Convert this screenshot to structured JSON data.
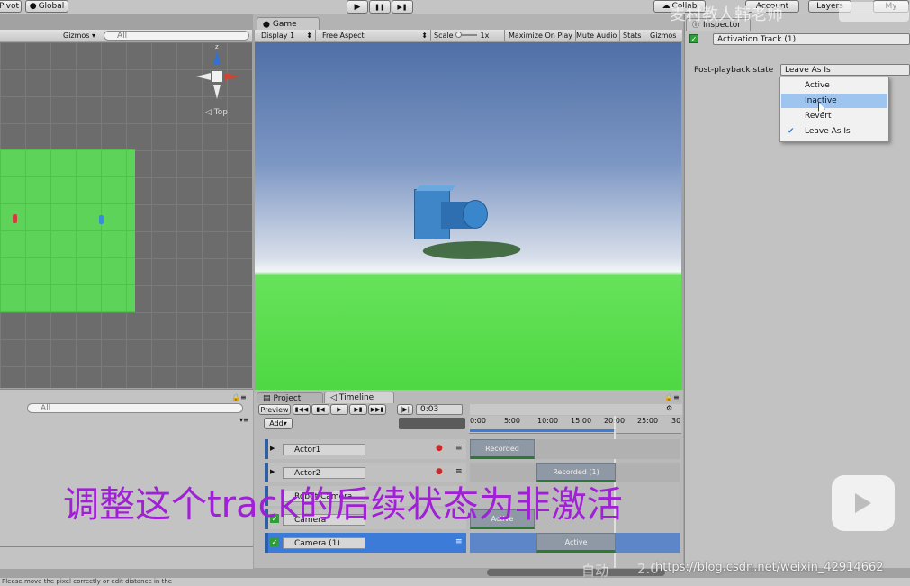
{
  "toolbar": {
    "pivot": "Pivot",
    "global": "Global",
    "play": "▶",
    "pause": "❚❚",
    "step": "▶❚",
    "collab": "Collab",
    "account": "Account",
    "layers": "Layers",
    "layout": "My"
  },
  "scene": {
    "gizmos": "Gizmos",
    "search_placeholder": "All",
    "view_label": "Top",
    "gizmo_axis_z": "z"
  },
  "game": {
    "tab": "Game",
    "display": "Display 1",
    "aspect": "Free Aspect",
    "scale_label": "Scale",
    "scale_value": "1x",
    "maximize": "Maximize On Play",
    "mute": "Mute Audio",
    "stats": "Stats",
    "gizmos": "Gizmos"
  },
  "inspector": {
    "tab": "Inspector",
    "track_name": "Activation Track (1)",
    "post_playback_label": "Post-playback state",
    "post_playback_value": "Leave As Is",
    "options": [
      {
        "label": "Active",
        "selected": false,
        "highlighted": false
      },
      {
        "label": "Inactive",
        "selected": false,
        "highlighted": true
      },
      {
        "label": "Revert",
        "selected": false,
        "highlighted": false
      },
      {
        "label": "Leave As Is",
        "selected": true,
        "highlighted": false
      }
    ]
  },
  "hierarchy": {
    "search_placeholder": "All"
  },
  "timeline": {
    "tab_project": "Project",
    "tab_timeline": "Timeline",
    "preview": "Preview",
    "time": "0:03",
    "add_button": "Add",
    "ruler": [
      "0:00",
      "5:00",
      "10:00",
      "15:00",
      "20:00",
      "25:00",
      "30"
    ],
    "tracks": [
      {
        "name": "Actor1",
        "clip": "Recorded"
      },
      {
        "name": "Actor2",
        "clip": "Recorded (1)"
      },
      {
        "name": "Robot Camera",
        "clip": ""
      },
      {
        "name": "Camera",
        "clip": "Active"
      },
      {
        "name": "Camera (1)",
        "clip": "Active"
      }
    ]
  },
  "status_bar": {
    "text": "Please move the pixel correctly or edit distance in the"
  },
  "overlay": {
    "subtitle": "调整这个track的后续状态为非激活",
    "watermark_top": "麦村教人韩老师",
    "watermark_bottom": "https://blog.csdn.net/weixin_42914662",
    "auto_label": "自动",
    "speed_label": "2.0"
  },
  "colors": {
    "accent_blue": "#3d7bd9",
    "track_green": "#2a7a31",
    "subtitle_purple": "#a11fd6",
    "ground_green": "#55d84a",
    "sky_top": "#4f6fa6"
  }
}
